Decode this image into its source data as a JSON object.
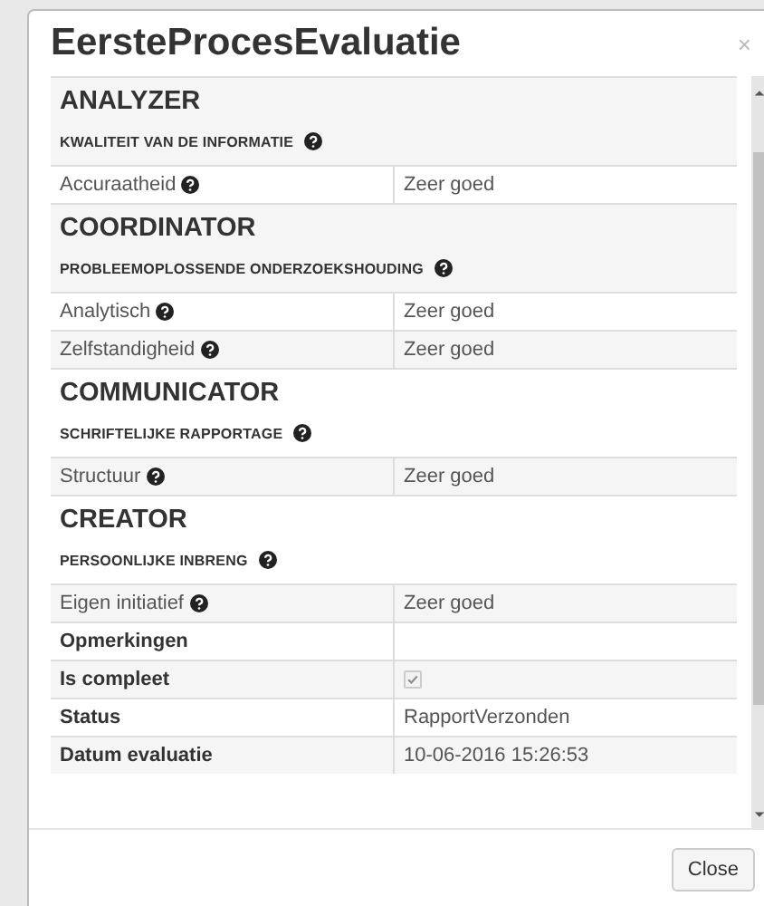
{
  "dialog": {
    "title": "EersteProcesEvaluatie",
    "close_icon": "×"
  },
  "sections": [
    {
      "heading": "ANALYZER",
      "subheading": "KWALITEIT VAN DE INFORMATIE",
      "rows": [
        {
          "label": "Accuraatheid",
          "value": "Zeer goed"
        }
      ]
    },
    {
      "heading": "COORDINATOR",
      "subheading": "PROBLEEMOPLOSSENDE ONDERZOEKSHOUDING",
      "rows": [
        {
          "label": "Analytisch",
          "value": "Zeer goed"
        },
        {
          "label": "Zelfstandigheid",
          "value": "Zeer goed"
        }
      ]
    },
    {
      "heading": "COMMUNICATOR",
      "subheading": "SCHRIFTELIJKE RAPPORTAGE",
      "rows": [
        {
          "label": "Structuur",
          "value": "Zeer goed"
        }
      ]
    },
    {
      "heading": "CREATOR",
      "subheading": "PERSOONLIJKE INBRENG",
      "rows": [
        {
          "label": "Eigen initiatief",
          "value": "Zeer goed"
        }
      ]
    }
  ],
  "fields": [
    {
      "label": "Opmerkingen",
      "kind": "text"
    },
    {
      "label": "Is compleet",
      "kind": "checkbox",
      "checked": true,
      "disabled": true
    },
    {
      "label": "Status",
      "kind": "text",
      "value": "RapportVerzonden"
    },
    {
      "label": "Datum evaluatie",
      "kind": "text",
      "value": "10-06-2016 15:26:53"
    }
  ],
  "footer": {
    "buttons": [
      "Close"
    ]
  }
}
